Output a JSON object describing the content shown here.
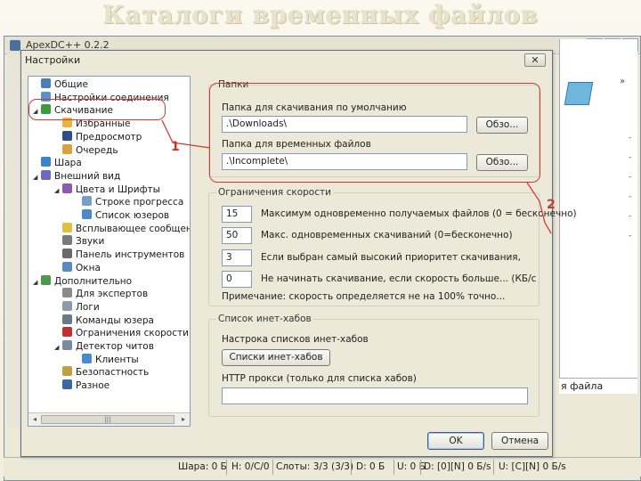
{
  "slide": {
    "title": "Каталоги временных файлов"
  },
  "background_window": {
    "title": "ApexDC++ 0.2.2",
    "controls": [
      "_",
      "□",
      "✕"
    ],
    "file_label": "я файла"
  },
  "dialog": {
    "title": "Настройки",
    "close": "✕",
    "tree": [
      {
        "label": "Общие",
        "level": 1,
        "icon": "user-icon",
        "color": "#4a7fb5"
      },
      {
        "label": "Настройки соединения",
        "level": 1,
        "icon": "network-icon",
        "color": "#5a8fd0"
      },
      {
        "label": "Скачивание",
        "level": 1,
        "icon": "download-icon",
        "color": "#3e9a3e",
        "expanded": true
      },
      {
        "label": "Избранные",
        "level": 2,
        "icon": "folder-icon",
        "color": "#e6b640"
      },
      {
        "label": "Предросмотр",
        "level": 2,
        "icon": "play-icon",
        "color": "#2c4f8a"
      },
      {
        "label": "Очередь",
        "level": 2,
        "icon": "queue-icon",
        "color": "#d9a040"
      },
      {
        "label": "Шара",
        "level": 1,
        "icon": "share-icon",
        "color": "#3d84c6"
      },
      {
        "label": "Внешний вид",
        "level": 1,
        "icon": "appearance-icon",
        "color": "#6a6ac0",
        "expanded": true
      },
      {
        "label": "Цвета и Шрифты",
        "level": 2,
        "icon": "palette-icon",
        "color": "#8a5ab0",
        "expanded": true
      },
      {
        "label": "Строке прогресса",
        "level": 3,
        "icon": "progress-icon",
        "color": "#7a9cc8"
      },
      {
        "label": "Список юзеров",
        "level": 3,
        "icon": "users-icon",
        "color": "#4a88c8"
      },
      {
        "label": "Всплывающее сообщения",
        "level": 2,
        "icon": "popup-icon",
        "color": "#e0c040"
      },
      {
        "label": "Звуки",
        "level": 2,
        "icon": "sound-icon",
        "color": "#7a7a7a"
      },
      {
        "label": "Панель инструментов",
        "level": 2,
        "icon": "toolbar-icon",
        "color": "#6a6a6a"
      },
      {
        "label": "Окна",
        "level": 2,
        "icon": "windows-icon",
        "color": "#5a8ac0"
      },
      {
        "label": "Дополнительно",
        "level": 1,
        "icon": "advanced-icon",
        "color": "#4a9a4a",
        "expanded": true
      },
      {
        "label": "Для экспертов",
        "level": 2,
        "icon": "expert-icon",
        "color": "#8a8a8a"
      },
      {
        "label": "Логи",
        "level": 2,
        "icon": "log-icon",
        "color": "#8a9aaa"
      },
      {
        "label": "Команды юзера",
        "level": 2,
        "icon": "commands-icon",
        "color": "#6a7a8a"
      },
      {
        "label": "Ограничения скорости",
        "level": 2,
        "icon": "speed-limit-icon",
        "color": "#c03030"
      },
      {
        "label": "Детектор читов",
        "level": 2,
        "icon": "detector-icon",
        "color": "#7a8aa0",
        "expanded": true
      },
      {
        "label": "Клиенты",
        "level": 3,
        "icon": "clients-icon",
        "color": "#4a8ad0"
      },
      {
        "label": "Безопастность",
        "level": 2,
        "icon": "lock-icon",
        "color": "#c0a040"
      },
      {
        "label": "Разное",
        "level": 2,
        "icon": "misc-icon",
        "color": "#3a6aa0"
      }
    ],
    "folders": {
      "legend": "Папки",
      "default_label": "Папка для скачивания по умолчанию",
      "default_value": ".\\Downloads\\",
      "temp_label": "Папка для временных файлов",
      "temp_value": ".\\Incomplete\\",
      "browse": "Обзо..."
    },
    "speed": {
      "legend": "Ограничения скорости",
      "rows": [
        {
          "value": "15",
          "label": "Максимум одновременно получаемых файлов (0 = бесконечно)"
        },
        {
          "value": "50",
          "label": "Макс. одновременных скачиваний (0=бесконечно)"
        },
        {
          "value": "3",
          "label": "Если выбран самый высокий приоритет скачивания,"
        },
        {
          "value": "0",
          "label": "Не начинать скачивание, если скорость больше... (КБ/с"
        }
      ],
      "note": "Примечание: скорость определяется не на 100% точно..."
    },
    "hubs": {
      "legend": "Список инет-хабов",
      "config_label": "Настрока списков инет-хабов",
      "button": "Списки инет-хабов",
      "proxy_label": "HTTP прокси (только для списка хабов)",
      "proxy_value": ""
    },
    "ok": "OK",
    "cancel": "Отмена"
  },
  "annotations": {
    "one": "1",
    "two": "2",
    "color": "#d23a3a"
  },
  "statusbar": {
    "share": "Шара: 0 Б",
    "hubs": "Н: 0/С/0",
    "slots": "Слоты: 3/3 (3/3)",
    "down": "D: 0 Б",
    "up": "U: 0 Б",
    "down_rate": "D: [0][N] 0 Б/s",
    "up_rate": "U: [С][N] 0 Б/s"
  }
}
